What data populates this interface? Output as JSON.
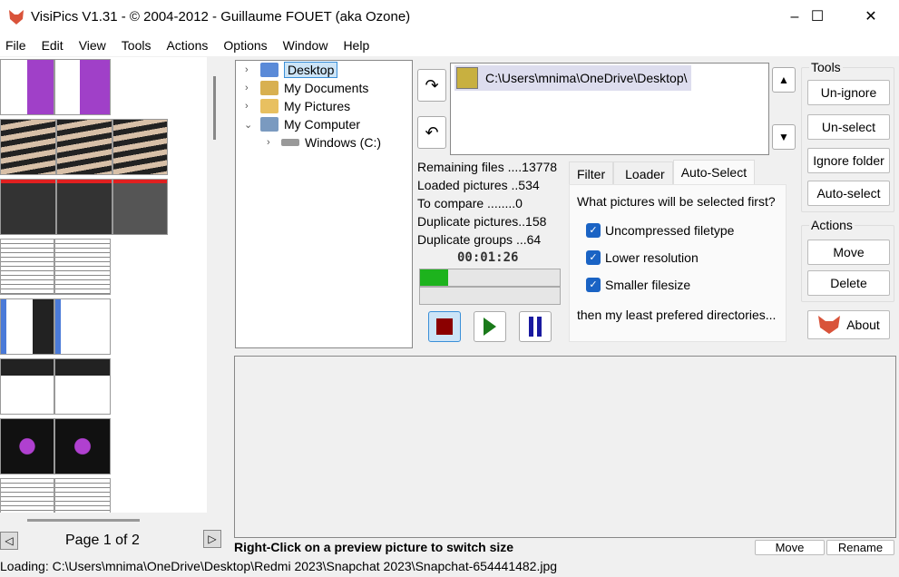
{
  "window": {
    "title": "VisiPics V1.31 - © 2004-2012 - Guillaume FOUET (aka Ozone)",
    "minimize": "–",
    "maximize": "☐",
    "close": "✕"
  },
  "menu": [
    "File",
    "Edit",
    "View",
    "Tools",
    "Actions",
    "Options",
    "Window",
    "Help"
  ],
  "thumbnails": {
    "page_label": "Page 1 of 2"
  },
  "tree": {
    "items": [
      {
        "label": "Desktop",
        "selected": true
      },
      {
        "label": "My Documents"
      },
      {
        "label": "My Pictures"
      },
      {
        "label": "My Computer",
        "expanded": true
      },
      {
        "label": "Windows (C:)"
      }
    ]
  },
  "folders": {
    "paths": [
      "C:\\Users\\mnima\\OneDrive\\Desktop\\"
    ]
  },
  "stats": {
    "remaining": "Remaining files ....13778",
    "loaded": "Loaded pictures ..534",
    "to_compare": "To compare ........0",
    "dup_pictures": "Duplicate pictures..158",
    "dup_groups": "Duplicate groups ...64",
    "timer": "00:01:26",
    "progress_percent": 20
  },
  "tabs": {
    "items": [
      "Filter",
      "Loader",
      "Auto-Select"
    ],
    "active": "Auto-Select"
  },
  "autoselect": {
    "question": "What pictures will be selected first?",
    "options": [
      {
        "label": "Uncompressed filetype",
        "checked": true
      },
      {
        "label": "Lower resolution",
        "checked": true
      },
      {
        "label": "Smaller filesize",
        "checked": true
      }
    ],
    "footer": "then my least prefered directories..."
  },
  "tools": {
    "title": "Tools",
    "unignore": "Un-ignore",
    "unselect": "Un-select",
    "ignore_folder": "Ignore folder",
    "auto_select": "Auto-select"
  },
  "actions": {
    "title": "Actions",
    "move": "Move",
    "delete": "Delete",
    "about": "About"
  },
  "preview": {
    "hint": "Right-Click on a preview picture to switch size",
    "move": "Move",
    "rename": "Rename"
  },
  "status": "Loading: C:\\Users\\mnima\\OneDrive\\Desktop\\Redmi 2023\\Snapchat 2023\\Snapchat-654441482.jpg",
  "colors": {
    "progress": "#1db31d",
    "stop": "#8b0000",
    "play": "#1a7a1a",
    "pause": "#1a1aa0",
    "checkbox": "#1a63c4"
  }
}
